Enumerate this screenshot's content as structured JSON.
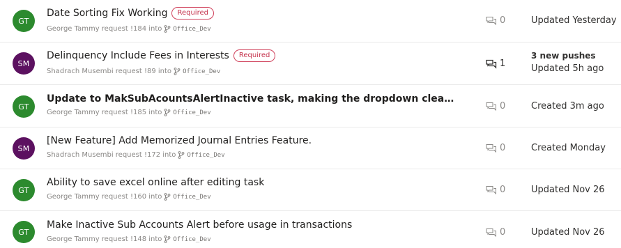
{
  "pull_requests": [
    {
      "initials": "GT",
      "avatar_color": "#2c8a2e",
      "title": "Date Sorting Fix Working",
      "required": "Required",
      "meta": "George Tammy request !184 into",
      "branch": "Office_Dev",
      "comments": "0",
      "status": "Updated Yesterday",
      "status_extra": ""
    },
    {
      "initials": "SM",
      "avatar_color": "#5c1160",
      "title": "Delinquency Include Fees in Interests",
      "required": "Required",
      "meta": "Shadrach Musembi request !89 into",
      "branch": "Office_Dev",
      "comments": "1",
      "status": "Updated 5h ago",
      "status_extra": "3 new pushes"
    },
    {
      "initials": "GT",
      "avatar_color": "#2c8a2e",
      "title": "Update to MakSubAcountsAlertInactive task, making the dropdown clear out when…",
      "required": "",
      "meta": "George Tammy request !185 into",
      "branch": "Office_Dev",
      "comments": "0",
      "status": "Created 3m ago",
      "status_extra": ""
    },
    {
      "initials": "SM",
      "avatar_color": "#5c1160",
      "title": "[New Feature] Add Memorized Journal Entries Feature.",
      "required": "",
      "meta": "Shadrach Musembi request !172 into",
      "branch": "Office_Dev",
      "comments": "0",
      "status": "Created Monday",
      "status_extra": ""
    },
    {
      "initials": "GT",
      "avatar_color": "#2c8a2e",
      "title": "Ability to save excel online after editing task",
      "required": "",
      "meta": "George Tammy request !160 into",
      "branch": "Office_Dev",
      "comments": "0",
      "status": "Updated Nov 26",
      "status_extra": ""
    },
    {
      "initials": "GT",
      "avatar_color": "#2c8a2e",
      "title": "Make Inactive Sub Accounts Alert before usage in transactions",
      "required": "",
      "meta": "George Tammy request !148 into",
      "branch": "Office_Dev",
      "comments": "0",
      "status": "Updated Nov 26",
      "status_extra": ""
    }
  ]
}
